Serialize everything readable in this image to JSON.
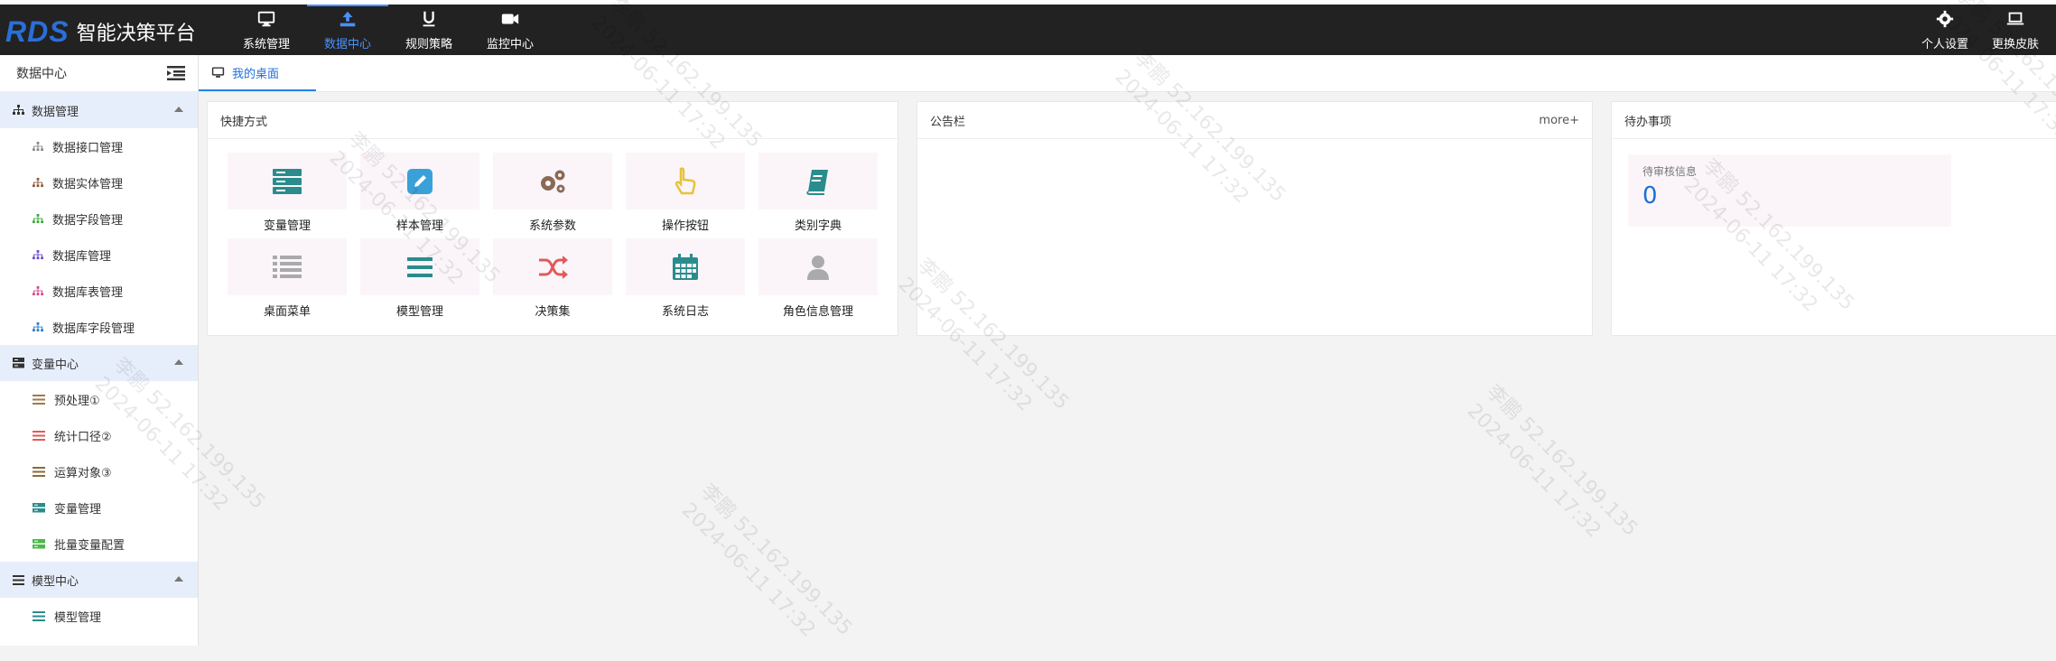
{
  "app": {
    "logo_mark": "RDS",
    "title": "智能决策平台"
  },
  "top_nav": [
    {
      "label": "系统管理",
      "icon": "monitor-icon",
      "active": false
    },
    {
      "label": "数据中心",
      "icon": "upload-icon",
      "active": true
    },
    {
      "label": "规则策略",
      "icon": "underline-icon",
      "active": false
    },
    {
      "label": "监控中心",
      "icon": "video-icon",
      "active": false
    }
  ],
  "top_right": [
    {
      "label": "个人设置",
      "icon": "gear-icon"
    },
    {
      "label": "更换皮肤",
      "icon": "laptop-icon"
    }
  ],
  "sidebar": {
    "title": "数据中心",
    "groups": [
      {
        "label": "数据管理",
        "items": [
          "数据接口管理",
          "数据实体管理",
          "数据字段管理",
          "数据库管理",
          "数据库表管理",
          "数据库字段管理"
        ]
      },
      {
        "label": "变量中心",
        "items": [
          "预处理①",
          "统计口径②",
          "运算对象③",
          "变量管理",
          "批量变量配置"
        ]
      },
      {
        "label": "模型中心",
        "items": [
          "模型管理"
        ]
      }
    ]
  },
  "tabs": [
    {
      "label": "我的桌面"
    }
  ],
  "shortcuts": {
    "title": "快捷方式",
    "items": [
      {
        "label": "变量管理",
        "icon": "server-icon",
        "color": "#2a8c8c"
      },
      {
        "label": "样本管理",
        "icon": "pencil-icon",
        "color": "#3aa0d8"
      },
      {
        "label": "系统参数",
        "icon": "gears-icon",
        "color": "#8a6a55"
      },
      {
        "label": "操作按钮",
        "icon": "hand-pointer-icon",
        "color": "#e6c33a"
      },
      {
        "label": "类别字典",
        "icon": "book-icon",
        "color": "#2a8c8c"
      },
      {
        "label": "桌面菜单",
        "icon": "list-icon",
        "color": "#aaaaaa"
      },
      {
        "label": "模型管理",
        "icon": "bars-icon",
        "color": "#2a8c8c"
      },
      {
        "label": "决策集",
        "icon": "shuffle-icon",
        "color": "#e05a5a"
      },
      {
        "label": "系统日志",
        "icon": "calendar-icon",
        "color": "#2a8c8c"
      },
      {
        "label": "角色信息管理",
        "icon": "user-icon",
        "color": "#aaaaaa"
      }
    ]
  },
  "notice": {
    "title": "公告栏",
    "more": "more+"
  },
  "todo": {
    "title": "待办事项",
    "card_title": "待审核信息",
    "count": "0"
  },
  "watermark": {
    "name": "李鹏",
    "ip": "52.162.199.135",
    "date": "2024-06-11 17:32"
  }
}
